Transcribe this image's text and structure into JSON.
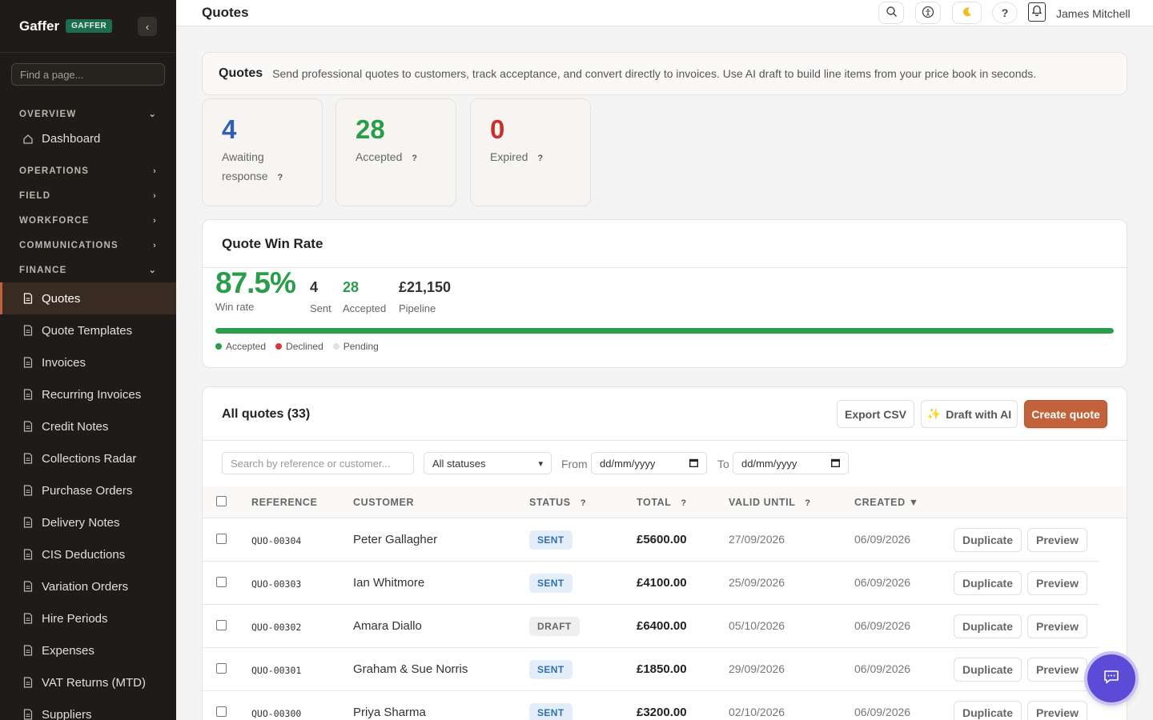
{
  "sidebar": {
    "brand": "Gaffer",
    "badge": "GAFFER",
    "search_placeholder": "Find a page...",
    "sections": {
      "overview": "OVERVIEW",
      "operations": "OPERATIONS",
      "field": "FIELD",
      "workforce": "WORKFORCE",
      "communications": "COMMUNICATIONS",
      "finance": "FINANCE"
    },
    "dashboard": "Dashboard",
    "finance_items": [
      {
        "label": "Quotes"
      },
      {
        "label": "Quote Templates"
      },
      {
        "label": "Invoices"
      },
      {
        "label": "Recurring Invoices"
      },
      {
        "label": "Credit Notes"
      },
      {
        "label": "Collections Radar"
      },
      {
        "label": "Purchase Orders"
      },
      {
        "label": "Delivery Notes"
      },
      {
        "label": "CIS Deductions"
      },
      {
        "label": "Variation Orders"
      },
      {
        "label": "Hire Periods"
      },
      {
        "label": "Expenses"
      },
      {
        "label": "VAT Returns (MTD)"
      },
      {
        "label": "Suppliers"
      }
    ],
    "active_item": "Quotes"
  },
  "topbar": {
    "title": "Quotes",
    "user": "James Mitchell",
    "icons": [
      "search-icon",
      "accessibility-icon",
      "moon-icon",
      "help-icon",
      "bell-icon"
    ],
    "help_label": "?"
  },
  "intro": {
    "title": "Quotes",
    "text": "Send professional quotes to customers, track acceptance, and convert directly to invoices. Use AI draft to build line items from your price book in seconds."
  },
  "stats": [
    {
      "value": "4",
      "label_line1": "Awaiting",
      "label_line2": "response",
      "color": "#2f5fb8"
    },
    {
      "value": "28",
      "label": "Accepted",
      "color": "#2a9d4a"
    },
    {
      "value": "0",
      "label": "Expired",
      "color": "#c8302b"
    }
  ],
  "help_mark": "?",
  "win_rate": {
    "title": "Quote Win Rate",
    "rate": "87.5%",
    "rate_label": "Win rate",
    "sent": "4",
    "sent_label": "Sent",
    "accepted": "28",
    "accepted_label": "Accepted",
    "pipeline": "£21,150",
    "pipeline_label": "Pipeline",
    "accepted_fraction": 1.0,
    "legend": [
      {
        "label": "Accepted",
        "color": "#2a9d4a"
      },
      {
        "label": "Declined",
        "color": "#d63a3a"
      },
      {
        "label": "Pending",
        "color": "#e2e2e2"
      }
    ]
  },
  "quotes": {
    "title": "All quotes (33)",
    "export_label": "Export CSV",
    "draft_label": "Draft with AI",
    "create_label": "Create quote",
    "search_placeholder": "Search by reference or customer...",
    "status_filter": "All statuses",
    "from_label": "From",
    "to_label": "To",
    "date_placeholder": "dd/mm/yyyy",
    "columns": {
      "reference": "REFERENCE",
      "customer": "CUSTOMER",
      "status": "STATUS",
      "total": "TOTAL",
      "valid_until": "VALID UNTIL",
      "created": "CREATED ▼"
    },
    "duplicate_label": "Duplicate",
    "preview_label": "Preview",
    "rows": [
      {
        "ref": "QUO-00304",
        "customer": "Peter Gallagher",
        "status": "SENT",
        "total": "£5600.00",
        "valid_until": "27/09/2026",
        "created": "06/09/2026"
      },
      {
        "ref": "QUO-00303",
        "customer": "Ian Whitmore",
        "status": "SENT",
        "total": "£4100.00",
        "valid_until": "25/09/2026",
        "created": "06/09/2026"
      },
      {
        "ref": "QUO-00302",
        "customer": "Amara Diallo",
        "status": "DRAFT",
        "total": "£6400.00",
        "valid_until": "05/10/2026",
        "created": "06/09/2026"
      },
      {
        "ref": "QUO-00301",
        "customer": "Graham & Sue Norris",
        "status": "SENT",
        "total": "£1850.00",
        "valid_until": "29/09/2026",
        "created": "06/09/2026"
      },
      {
        "ref": "QUO-00300",
        "customer": "Priya Sharma",
        "status": "SENT",
        "total": "£3200.00",
        "valid_until": "02/10/2026",
        "created": "06/09/2026"
      }
    ]
  }
}
